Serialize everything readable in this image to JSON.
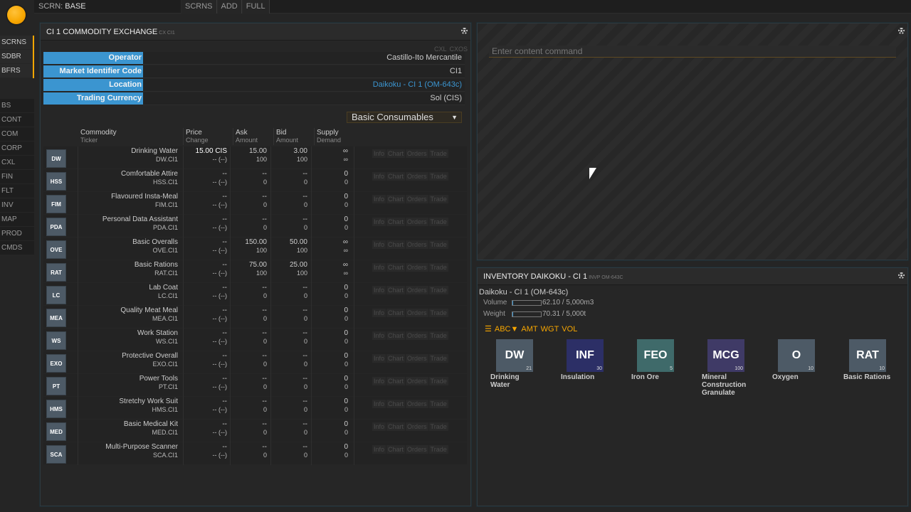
{
  "topbar": {
    "scrn_label": "SCRN:",
    "scrn_name": "BASE",
    "buttons": [
      "SCRNS",
      "ADD",
      "FULL"
    ]
  },
  "nav_top": [
    "SCRNS",
    "SDBR",
    "BFRS"
  ],
  "nav_main": [
    "BS",
    "CONT",
    "COM",
    "CORP",
    "CXL",
    "FIN",
    "FLT",
    "INV",
    "MAP",
    "PROD",
    "CMDS"
  ],
  "cx": {
    "title": "CI 1 COMMODITY EXCHANGE",
    "title_code": "CX CI1",
    "tags": [
      "CXL",
      "CXOS"
    ],
    "info": [
      {
        "key": "Operator",
        "value": "Castillo-Ito Mercantile"
      },
      {
        "key": "Market Identifier Code",
        "value": "CI1"
      },
      {
        "key": "Location",
        "value": "Daikoku - CI 1 (OM-643c)"
      },
      {
        "key": "Trading Currency",
        "value": "Sol (CIS)"
      }
    ],
    "category": "Basic Consumables",
    "headers": {
      "commodity": "Commodity",
      "ticker": "Ticker",
      "price": "Price",
      "change": "Change",
      "ask": "Ask",
      "ask_amt": "Amount",
      "bid": "Bid",
      "bid_amt": "Amount",
      "supply": "Supply",
      "demand": "Demand"
    },
    "actions": [
      "Info",
      "Chart",
      "Orders",
      "Trade"
    ],
    "rows": [
      {
        "t": "DW",
        "name": "Drinking Water",
        "ticker": "DW.CI1",
        "price": "15.00 CIS",
        "change": "-- (--)",
        "ask": "15.00",
        "ask_amt": "100",
        "bid": "3.00",
        "bid_amt": "100",
        "supply": "∞",
        "demand": "∞"
      },
      {
        "t": "HSS",
        "name": "Comfortable Attire",
        "ticker": "HSS.CI1",
        "price": "--",
        "change": "-- (--)",
        "ask": "--",
        "ask_amt": "0",
        "bid": "--",
        "bid_amt": "0",
        "supply": "0",
        "demand": "0"
      },
      {
        "t": "FIM",
        "name": "Flavoured Insta-Meal",
        "ticker": "FIM.CI1",
        "price": "--",
        "change": "-- (--)",
        "ask": "--",
        "ask_amt": "0",
        "bid": "--",
        "bid_amt": "0",
        "supply": "0",
        "demand": "0"
      },
      {
        "t": "PDA",
        "name": "Personal Data Assistant",
        "ticker": "PDA.CI1",
        "price": "--",
        "change": "-- (--)",
        "ask": "--",
        "ask_amt": "0",
        "bid": "--",
        "bid_amt": "0",
        "supply": "0",
        "demand": "0"
      },
      {
        "t": "OVE",
        "name": "Basic Overalls",
        "ticker": "OVE.CI1",
        "price": "--",
        "change": "-- (--)",
        "ask": "150.00",
        "ask_amt": "100",
        "bid": "50.00",
        "bid_amt": "100",
        "supply": "∞",
        "demand": "∞"
      },
      {
        "t": "RAT",
        "name": "Basic Rations",
        "ticker": "RAT.CI1",
        "price": "--",
        "change": "-- (--)",
        "ask": "75.00",
        "ask_amt": "100",
        "bid": "25.00",
        "bid_amt": "100",
        "supply": "∞",
        "demand": "∞"
      },
      {
        "t": "LC",
        "name": "Lab Coat",
        "ticker": "LC.CI1",
        "price": "--",
        "change": "-- (--)",
        "ask": "--",
        "ask_amt": "0",
        "bid": "--",
        "bid_amt": "0",
        "supply": "0",
        "demand": "0"
      },
      {
        "t": "MEA",
        "name": "Quality Meat Meal",
        "ticker": "MEA.CI1",
        "price": "--",
        "change": "-- (--)",
        "ask": "--",
        "ask_amt": "0",
        "bid": "--",
        "bid_amt": "0",
        "supply": "0",
        "demand": "0"
      },
      {
        "t": "WS",
        "name": "Work Station",
        "ticker": "WS.CI1",
        "price": "--",
        "change": "-- (--)",
        "ask": "--",
        "ask_amt": "0",
        "bid": "--",
        "bid_amt": "0",
        "supply": "0",
        "demand": "0"
      },
      {
        "t": "EXO",
        "name": "Protective Overall",
        "ticker": "EXO.CI1",
        "price": "--",
        "change": "-- (--)",
        "ask": "--",
        "ask_amt": "0",
        "bid": "--",
        "bid_amt": "0",
        "supply": "0",
        "demand": "0"
      },
      {
        "t": "PT",
        "name": "Power Tools",
        "ticker": "PT.CI1",
        "price": "--",
        "change": "-- (--)",
        "ask": "--",
        "ask_amt": "0",
        "bid": "--",
        "bid_amt": "0",
        "supply": "0",
        "demand": "0"
      },
      {
        "t": "HMS",
        "name": "Stretchy Work Suit",
        "ticker": "HMS.CI1",
        "price": "--",
        "change": "-- (--)",
        "ask": "--",
        "ask_amt": "0",
        "bid": "--",
        "bid_amt": "0",
        "supply": "0",
        "demand": "0"
      },
      {
        "t": "MED",
        "name": "Basic Medical Kit",
        "ticker": "MED.CI1",
        "price": "--",
        "change": "-- (--)",
        "ask": "--",
        "ask_amt": "0",
        "bid": "--",
        "bid_amt": "0",
        "supply": "0",
        "demand": "0"
      },
      {
        "t": "SCA",
        "name": "Multi-Purpose Scanner",
        "ticker": "SCA.CI1",
        "price": "--",
        "change": "-- (--)",
        "ask": "--",
        "ask_amt": "0",
        "bid": "--",
        "bid_amt": "0",
        "supply": "0",
        "demand": "0"
      }
    ]
  },
  "command": {
    "placeholder": "Enter content command"
  },
  "inv": {
    "title": "INVENTORY DAIKOKU - CI 1",
    "title_code": "INVP OM-643C",
    "location": "Daikoku - CI 1 (OM-643c)",
    "volume_label": "Volume",
    "volume_value": "62.10 / 5,000m3",
    "volume_fill": 0.0124,
    "weight_label": "Weight",
    "weight_value": "70.31 / 5,000t",
    "weight_fill": 0.0141,
    "sorts": [
      "ABC▼",
      "AMT",
      "WGT",
      "VOL"
    ],
    "items": [
      {
        "t": "DW",
        "name": "Drinking Water",
        "count": "21",
        "color": "#4d5a66"
      },
      {
        "t": "INF",
        "name": "Insulation",
        "count": "30",
        "color": "#2c2f66"
      },
      {
        "t": "FEO",
        "name": "Iron Ore",
        "count": "5",
        "color": "#3f6a6a"
      },
      {
        "t": "MCG",
        "name": "Mineral Construction Granulate",
        "count": "100",
        "color": "#3f3a66"
      },
      {
        "t": "O",
        "name": "Oxygen",
        "count": "10",
        "color": "#4d5a66"
      },
      {
        "t": "RAT",
        "name": "Basic Rations",
        "count": "10",
        "color": "#4d5a66"
      }
    ]
  }
}
